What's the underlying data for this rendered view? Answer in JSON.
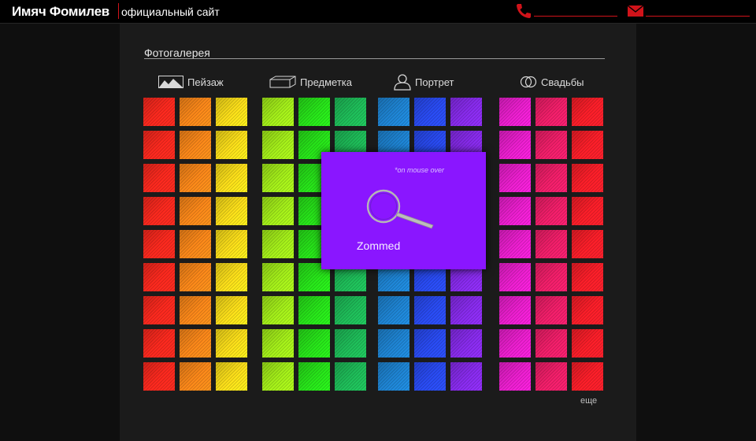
{
  "header": {
    "brand": "Имяч Фомилев",
    "tagline": "официальный сайт",
    "accent_color": "#d0131a",
    "contacts": [
      {
        "icon": "phone-icon"
      },
      {
        "icon": "mail-icon"
      }
    ]
  },
  "gallery": {
    "title": "Фотогалерея",
    "categories": [
      {
        "id": "landscape",
        "label": "Пейзаж",
        "icon": "landscape-icon"
      },
      {
        "id": "still-life",
        "label": "Предметка",
        "icon": "box-icon"
      },
      {
        "id": "portrait",
        "label": "Портрет",
        "icon": "person-icon"
      },
      {
        "id": "weddings",
        "label": "Свадьбы",
        "icon": "rings-icon"
      }
    ],
    "rows": 9,
    "column_colors": [
      "#ff2a1f",
      "#ff8a1a",
      "#ffe21a",
      "#a6f21a",
      "#28e81a",
      "#1fbf5a",
      "#1f86d6",
      "#2a4cf5",
      "#8a2cf0",
      "#ef1fd2",
      "#f51f6b",
      "#ff1f2a"
    ],
    "more_label": "еще"
  },
  "zoom": {
    "note": "*on mouse over",
    "label": "Zommed",
    "icon": "magnifier-icon",
    "color": "#8a16ff"
  }
}
